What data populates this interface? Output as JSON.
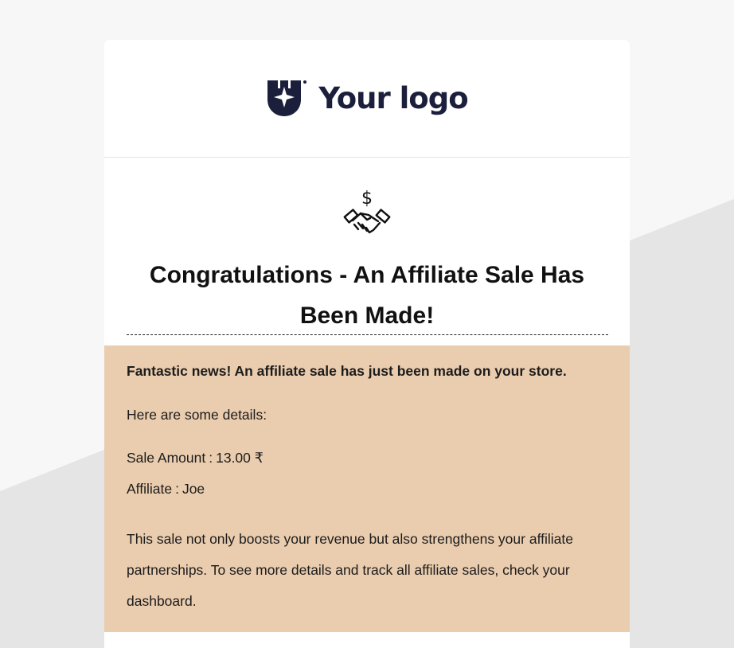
{
  "logo": {
    "text": "Your logo",
    "icon": "shield-star-icon",
    "color": "#1b1f3b"
  },
  "hero": {
    "icon": "handshake-dollar-icon",
    "title": "Congratulations - An Affiliate Sale Has Been Made!"
  },
  "content": {
    "background": "#eaccae",
    "intro": "Fantastic news! An affiliate sale has just been made on your store.",
    "details_label": "Here are some details:",
    "sale_amount_label": "Sale Amount",
    "sale_amount_value": "13.00 ₹",
    "affiliate_label": "Affiliate",
    "affiliate_value": "Joe",
    "body": "This sale not only boosts your revenue but also strengthens your affiliate partnerships. To see more details and track all affiliate sales, check your dashboard."
  }
}
